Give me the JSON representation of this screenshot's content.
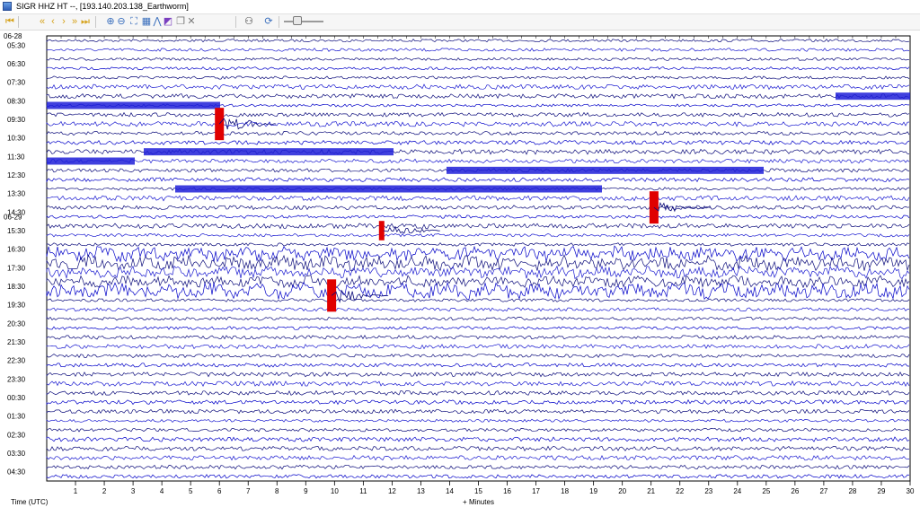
{
  "window": {
    "title": "SIGR HHZ HT --, [193.140.203.138_Earthworm]"
  },
  "toolbar": {
    "buttons": [
      {
        "name": "first-page-icon",
        "glyph": "⏮",
        "color": "#d6a21a"
      },
      {
        "name": "prev-page-icon",
        "glyph": "«",
        "color": "#d6a21a"
      },
      {
        "name": "prev-icon",
        "glyph": "‹",
        "color": "#d6a21a"
      },
      {
        "name": "next-icon",
        "glyph": "›",
        "color": "#d6a21a"
      },
      {
        "name": "next-page-icon",
        "glyph": "»",
        "color": "#d6a21a"
      },
      {
        "name": "last-page-icon",
        "glyph": "⏭",
        "color": "#d6a21a"
      },
      {
        "name": "zoom-in-icon",
        "glyph": "⊕",
        "color": "#3a6fbd"
      },
      {
        "name": "zoom-out-icon",
        "glyph": "⊖",
        "color": "#3a6fbd"
      },
      {
        "name": "zoom-fit-icon",
        "glyph": "⛶",
        "color": "#3a6fbd"
      },
      {
        "name": "grid-icon",
        "glyph": "▦",
        "color": "#3a6fbd"
      },
      {
        "name": "spectrum-icon",
        "glyph": "⋀",
        "color": "#3a6fbd"
      },
      {
        "name": "color-icon",
        "glyph": "◩",
        "color": "#7a3fbf"
      },
      {
        "name": "copy-icon",
        "glyph": "❐",
        "color": "#7a7a7a"
      },
      {
        "name": "clear-icon",
        "glyph": "✕",
        "color": "#7a7a7a"
      },
      {
        "name": "users-icon",
        "glyph": "⚇",
        "color": "#333333"
      },
      {
        "name": "refresh-icon",
        "glyph": "⟳",
        "color": "#3a6fbd"
      }
    ]
  },
  "helicorder": {
    "trace_colors": [
      "#000000",
      "#cc0000",
      "#0000e0",
      "#008000"
    ],
    "day_labels": [
      {
        "text": "06-28",
        "row": 0
      },
      {
        "text": "06-29",
        "row": 19.5
      }
    ],
    "hour_labels": [
      "05:30",
      "06:30",
      "07:30",
      "08:30",
      "09:30",
      "10:30",
      "11:30",
      "12:30",
      "13:30",
      "14:30",
      "15:30",
      "16:30",
      "17:30",
      "18:30",
      "19:30",
      "20:30",
      "21:30",
      "22:30",
      "23:30",
      "00:30",
      "01:30",
      "02:30",
      "03:30",
      "04:30"
    ],
    "x_ticks": [
      "1",
      "2",
      "3",
      "4",
      "5",
      "6",
      "7",
      "8",
      "9",
      "10",
      "11",
      "12",
      "13",
      "14",
      "15",
      "16",
      "17",
      "18",
      "19",
      "20",
      "21",
      "22",
      "23",
      "24",
      "25",
      "26",
      "27",
      "28",
      "29",
      "30"
    ],
    "x_label": "+ Minutes",
    "y_label": "Time (UTC)",
    "events": [
      {
        "row": 9,
        "minute": 6.0,
        "strength": 1
      },
      {
        "row": 18,
        "minute": 21.1,
        "strength": 1
      },
      {
        "row": 20.5,
        "minute": 11.7,
        "strength": 0.6
      },
      {
        "row": 27.5,
        "minute": 9.9,
        "strength": 1
      }
    ]
  }
}
